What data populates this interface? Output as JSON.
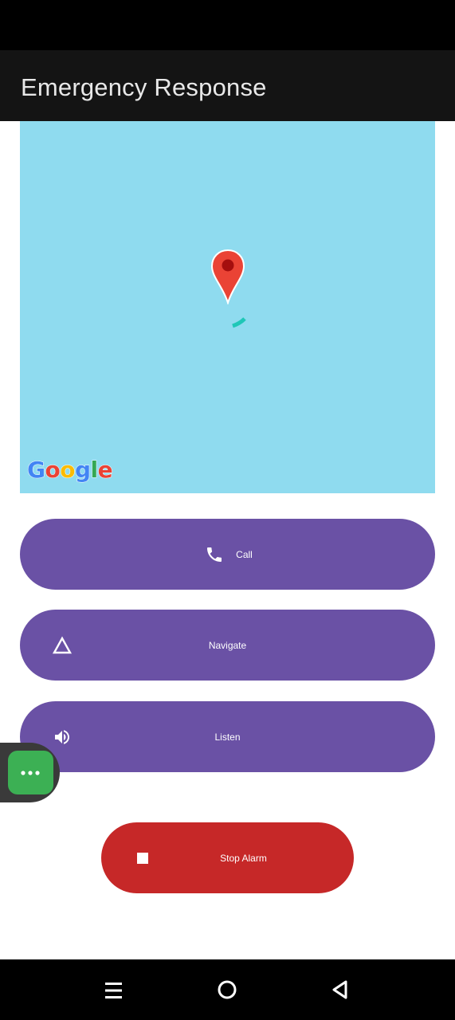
{
  "app": {
    "title": "Emergency Response"
  },
  "map": {
    "attribution": "Google",
    "background_color": "#8fdbef",
    "marker_icon": "map-pin-icon",
    "marker_color": "#ea4335"
  },
  "actions": {
    "call": {
      "label": "Call",
      "icon": "phone-icon"
    },
    "navigate": {
      "label": "Navigate",
      "icon": "navigation-triangle-icon"
    },
    "listen": {
      "label": "Listen",
      "icon": "speaker-icon"
    },
    "stop_alarm": {
      "label": "Stop Alarm",
      "icon": "stop-icon"
    }
  },
  "colors": {
    "app_bar": "#141414",
    "action_button": "#6a51a5",
    "stop_button": "#c62828",
    "chat_head": "#3cb054"
  },
  "chat_head": {
    "icon": "more-dots-icon"
  },
  "system_nav": {
    "recents_icon": "menu-lines-icon",
    "home_icon": "home-circle-icon",
    "back_icon": "back-triangle-icon"
  }
}
